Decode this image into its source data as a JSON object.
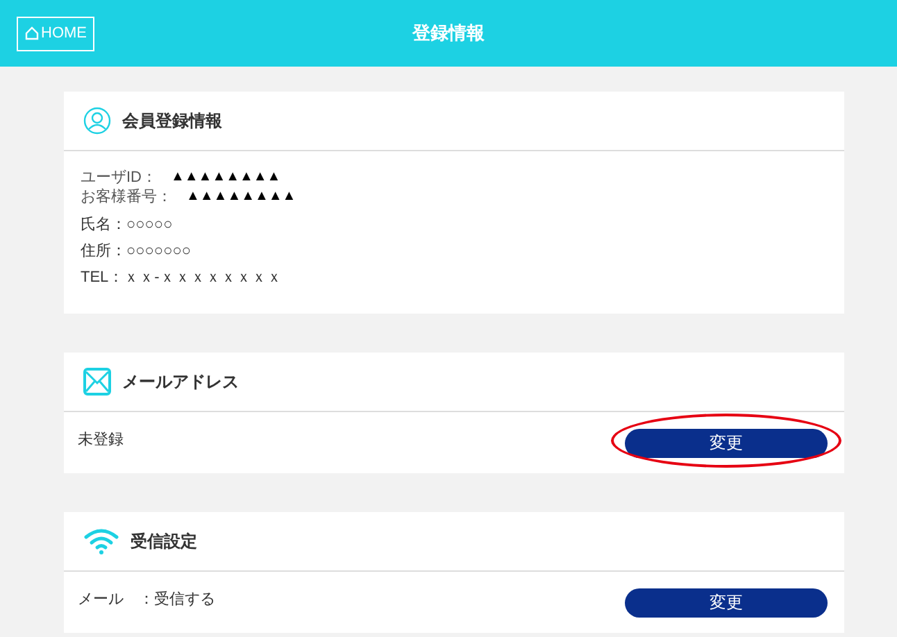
{
  "header": {
    "home_button": "HOME",
    "title": "登録情報"
  },
  "sections": [
    {
      "kind": "profile",
      "title": "会員登録情報",
      "ids": [
        {
          "label": "ユーザID：",
          "value": "▲▲▲▲▲▲▲▲"
        },
        {
          "label": "お客様番号：",
          "value": "▲▲▲▲▲▲▲▲"
        }
      ],
      "lines": [
        "氏名：○○○○○",
        "住所：○○○○○○○",
        "TEL：ｘｘ-ｘｘｘｘｘｘｘｘ"
      ]
    },
    {
      "kind": "setting",
      "title": "メールアドレス",
      "value": "未登録",
      "button": "変更",
      "highlighted": true
    },
    {
      "kind": "setting",
      "title": "受信設定",
      "value": "メール　：受信する",
      "button": "変更",
      "highlighted": false
    }
  ]
}
